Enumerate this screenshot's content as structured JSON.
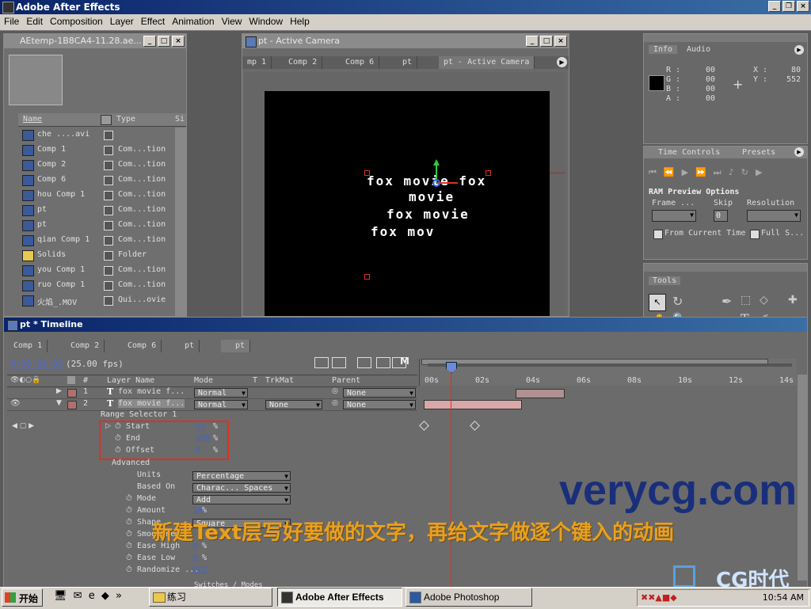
{
  "app": {
    "title": "Adobe After Effects"
  },
  "menu": [
    "File",
    "Edit",
    "Composition",
    "Layer",
    "Effect",
    "Animation",
    "View",
    "Window",
    "Help"
  ],
  "project": {
    "title": "AEtemp-1B8CA4-11.28.ae...",
    "columns": {
      "name": "Name",
      "type": "Type",
      "size": "Si"
    },
    "items": [
      {
        "name": "che ....avi",
        "type": ""
      },
      {
        "name": "Comp 1",
        "type": "Com...tion"
      },
      {
        "name": "Comp 2",
        "type": "Com...tion"
      },
      {
        "name": "Comp 6",
        "type": "Com...tion"
      },
      {
        "name": "hou Comp 1",
        "type": "Com...tion"
      },
      {
        "name": "pt",
        "type": "Com...tion"
      },
      {
        "name": "pt",
        "type": "Com...tion"
      },
      {
        "name": "qian Comp 1",
        "type": "Com...tion"
      },
      {
        "name": "Solids",
        "type": "Folder"
      },
      {
        "name": "you Comp 1",
        "type": "Com...tion"
      },
      {
        "name": "ruo Comp 1",
        "type": "Com...tion"
      },
      {
        "name": "火焰_.MOV",
        "type": "Qui...ovie"
      }
    ]
  },
  "comp_window": {
    "title": "pt - Active Camera",
    "tabs": [
      "mp 1",
      "Comp 2",
      "Comp 6",
      "pt",
      "pt - Active Camera"
    ],
    "text_lines": [
      "fox movie fox",
      "movie",
      "fox movie",
      "fox mov"
    ]
  },
  "info": {
    "tabs": [
      "Info",
      "Audio"
    ],
    "r": "00",
    "g": "00",
    "b": "00",
    "a": "00",
    "x": "80",
    "y": "552",
    "labels": {
      "r": "R :",
      "g": "G :",
      "b": "B :",
      "a": "A :",
      "x": "X :",
      "y": "Y :"
    }
  },
  "time_controls": {
    "tabs": [
      "Time Controls",
      "Presets"
    ],
    "ram_preview": "RAM Preview Options",
    "frame_label": "Frame ...",
    "skip_label": "Skip",
    "resolution_label": "Resolution",
    "skip_value": "0",
    "from_current_time": "From Current Time",
    "full_screen": "Full S..."
  },
  "tools": {
    "tab": "Tools"
  },
  "timeline": {
    "title": "pt * Timeline",
    "tabs": [
      "Comp 1",
      "Comp 2",
      "Comp 6",
      "pt",
      "pt"
    ],
    "current_time": "0:00:01:02",
    "fps": "(25.00 fps)",
    "columns": {
      "num": "#",
      "layer_name": "Layer Name",
      "mode": "Mode",
      "t": "T",
      "trkmat": "TrkMat",
      "parent": "Parent"
    },
    "ruler": [
      "00s",
      "02s",
      "04s",
      "06s",
      "08s",
      "10s",
      "12s",
      "14s"
    ],
    "layers": [
      {
        "num": "1",
        "name": "fox movie f...",
        "mode": "Normal",
        "trkmat": "",
        "parent": "None"
      },
      {
        "num": "2",
        "name": "fox movie f...",
        "mode": "Normal",
        "trkmat": "None",
        "parent": "None"
      }
    ],
    "range_selector": "Range Selector 1",
    "props": [
      {
        "label": "Start",
        "value": "54",
        "unit": "%"
      },
      {
        "label": "End",
        "value": "100",
        "unit": "%"
      },
      {
        "label": "Offset",
        "value": "0",
        "unit": "%"
      }
    ],
    "advanced": "Advanced",
    "adv": [
      {
        "label": "Units",
        "dropdown": "Percentage"
      },
      {
        "label": "Based On",
        "dropdown": "Charac... Spaces"
      },
      {
        "label": "Mode",
        "dropdown": "Add"
      },
      {
        "label": "Amount",
        "value": "100",
        "unit": "%"
      },
      {
        "label": "Shape",
        "dropdown": "Square"
      },
      {
        "label": "Smoothness",
        "value": "",
        "unit": ""
      },
      {
        "label": "Ease High",
        "value": "0",
        "unit": "%"
      },
      {
        "label": "Ease Low",
        "value": "0",
        "unit": "%"
      },
      {
        "label": "Randomize ...",
        "value": "Off",
        "unit": ""
      }
    ],
    "switches": "Switches / Modes"
  },
  "overlay": {
    "watermark": "verycg.com",
    "caption": "新建Text层写好要做的文字，再给文字做逐个键入的动画",
    "logo": "CG时代"
  },
  "taskbar": {
    "start": "开始",
    "buttons": [
      "练习",
      "Adobe After Effects",
      "Adobe Photoshop"
    ],
    "clock": "10:54 AM"
  },
  "colors": {
    "highlight": "#e03020",
    "playhead": "#e03020",
    "watermark": "#1a2f7a",
    "caption": "#e8a020"
  }
}
